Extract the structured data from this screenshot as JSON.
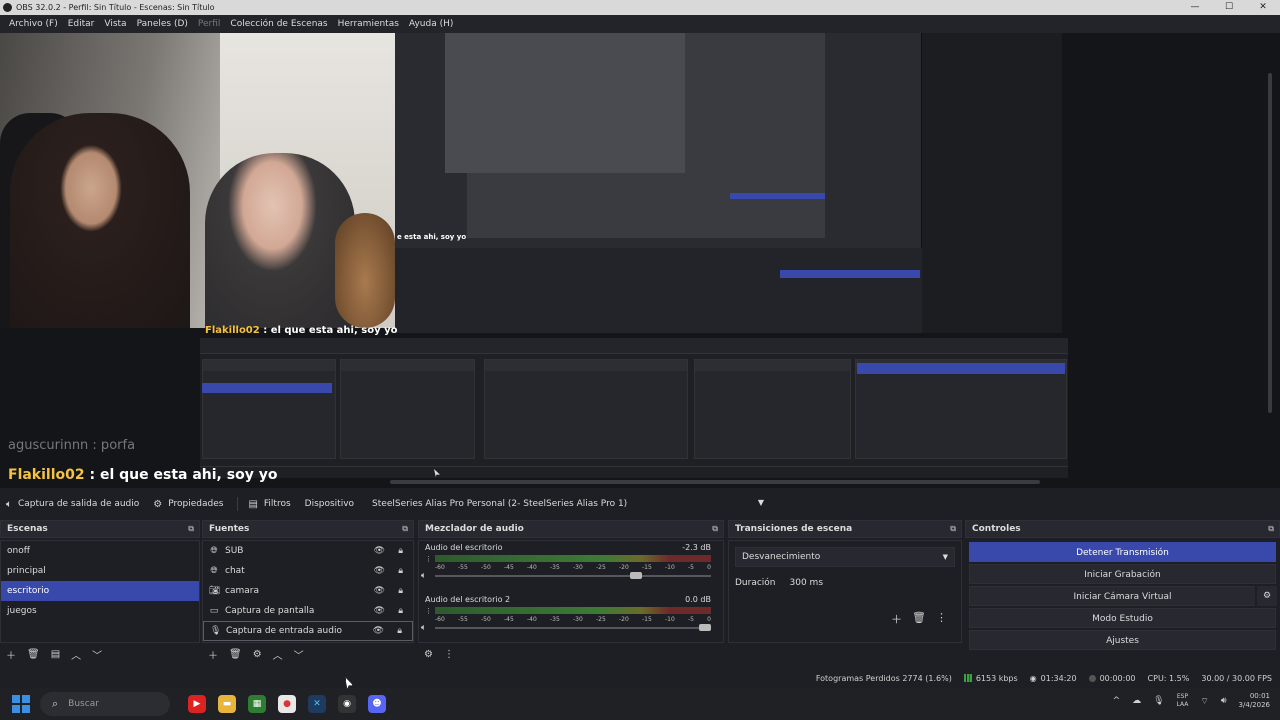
{
  "window": {
    "title": "OBS 32.0.2 - Perfil: Sin Título - Escenas: Sin Título",
    "controls": [
      "—",
      "☐",
      "✕"
    ]
  },
  "menu": [
    "Archivo (F)",
    "Editar",
    "Vista",
    "Paneles (D)",
    "Perfil",
    "Colección de Escenas",
    "Herramientas",
    "Ayuda (H)"
  ],
  "preview": {
    "overlay_chat": {
      "nick": "Flakillo02",
      "text": " : el que esta ahi, soy yo"
    },
    "nested_label": "e esta ahi, soy yo",
    "chat_faded": "aguscurinnn : porfa",
    "chat_main": {
      "nick": "Flakillo02",
      "text": " : el que esta ahi, soy yo"
    }
  },
  "context_bar": {
    "source": "Captura de salida de audio",
    "properties": "Propiedades",
    "filters": "Filtros",
    "device_label": "Dispositivo",
    "device_value": "SteelSeries Alias Pro Personal (2- SteelSeries Alias Pro 1)"
  },
  "scenes": {
    "title": "Escenas",
    "items": [
      "onoff",
      "principal",
      "escritorio",
      "juegos"
    ],
    "selected_index": 2
  },
  "sources": {
    "title": "Fuentes",
    "items": [
      {
        "label": "SUB",
        "icon": "browser-icon"
      },
      {
        "label": "chat",
        "icon": "browser-icon"
      },
      {
        "label": "camara",
        "icon": "camera-icon"
      },
      {
        "label": "Captura de pantalla",
        "icon": "monitor-icon"
      },
      {
        "label": "Captura de entrada audio",
        "icon": "mic-icon"
      }
    ]
  },
  "mixer": {
    "title": "Mezclador de audio",
    "channels": [
      {
        "name": "Audio del escritorio",
        "db": "-2.3 dB",
        "volume_pct": 75
      },
      {
        "name": "Audio del escritorio 2",
        "db": "0.0 dB",
        "volume_pct": 100
      }
    ],
    "ticks": [
      "-60",
      "-55",
      "-50",
      "-45",
      "-40",
      "-35",
      "-30",
      "-25",
      "-20",
      "-15",
      "-10",
      "-5",
      "0"
    ]
  },
  "transitions": {
    "title": "Transiciones de escena",
    "selected": "Desvanecimiento",
    "duration_label": "Duración",
    "duration_value": "300 ms"
  },
  "controls": {
    "title": "Controles",
    "buttons": [
      "Detener Transmisión",
      "Iniciar Grabación",
      "Iniciar Cámara Virtual",
      "Modo Estudio",
      "Ajustes"
    ]
  },
  "status": {
    "dropped": "Fotogramas Perdidos 2774 (1.6%)",
    "bitrate": "6153 kbps",
    "stream_time": "01:34:20",
    "rec_time": "00:00:00",
    "cpu": "CPU: 1.5%",
    "fps": "30.00 / 30.00 FPS"
  },
  "taskbar": {
    "search_placeholder": "Buscar",
    "lang_top": "ESP",
    "lang_bottom": "LAA",
    "time": "00:01",
    "date": "3/4/2026"
  },
  "colors": {
    "accent": "#3949ab",
    "panel": "#1e1f24",
    "header": "#272830",
    "nick": "#f5c242"
  }
}
